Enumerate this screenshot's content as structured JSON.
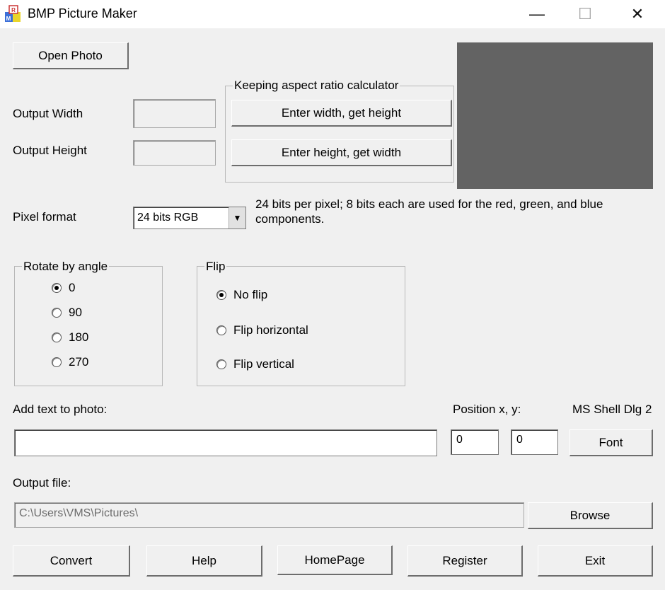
{
  "window": {
    "title": "BMP Picture Maker",
    "minimize_glyph": "—",
    "maximize_glyph": "☐",
    "close_glyph": "✕"
  },
  "open_photo_label": "Open Photo",
  "output_width_label": "Output Width",
  "output_height_label": "Output Height",
  "output_width_value": "",
  "output_height_value": "",
  "aspect": {
    "group_label": "Keeping aspect ratio calculator",
    "width_btn": "Enter width, get height",
    "height_btn": "Enter height, get width"
  },
  "pixel_format": {
    "label": "Pixel format",
    "selected": "24 bits RGB",
    "description": "24 bits per pixel; 8 bits each are used for the red, green, and blue components."
  },
  "rotate": {
    "group_label": "Rotate by angle",
    "options": [
      "0",
      "90",
      "180",
      "270"
    ],
    "selected_index": 0
  },
  "flip": {
    "group_label": "Flip",
    "options": [
      "No flip",
      "Flip horizontal",
      "Flip vertical"
    ],
    "selected_index": 0
  },
  "text": {
    "label": "Add text to photo:",
    "value": "",
    "position_label": "Position x, y:",
    "x": "0",
    "y": "0",
    "font_name": "MS Shell Dlg 2",
    "font_btn": "Font"
  },
  "output": {
    "label": "Output file:",
    "path": "C:\\Users\\VMS\\Pictures\\",
    "browse_btn": "Browse"
  },
  "buttons": {
    "convert": "Convert",
    "help": "Help",
    "homepage": "HomePage",
    "register": "Register",
    "exit": "Exit"
  },
  "colors": {
    "preview_bg": "#636363",
    "window_bg": "#f0f0f0"
  }
}
